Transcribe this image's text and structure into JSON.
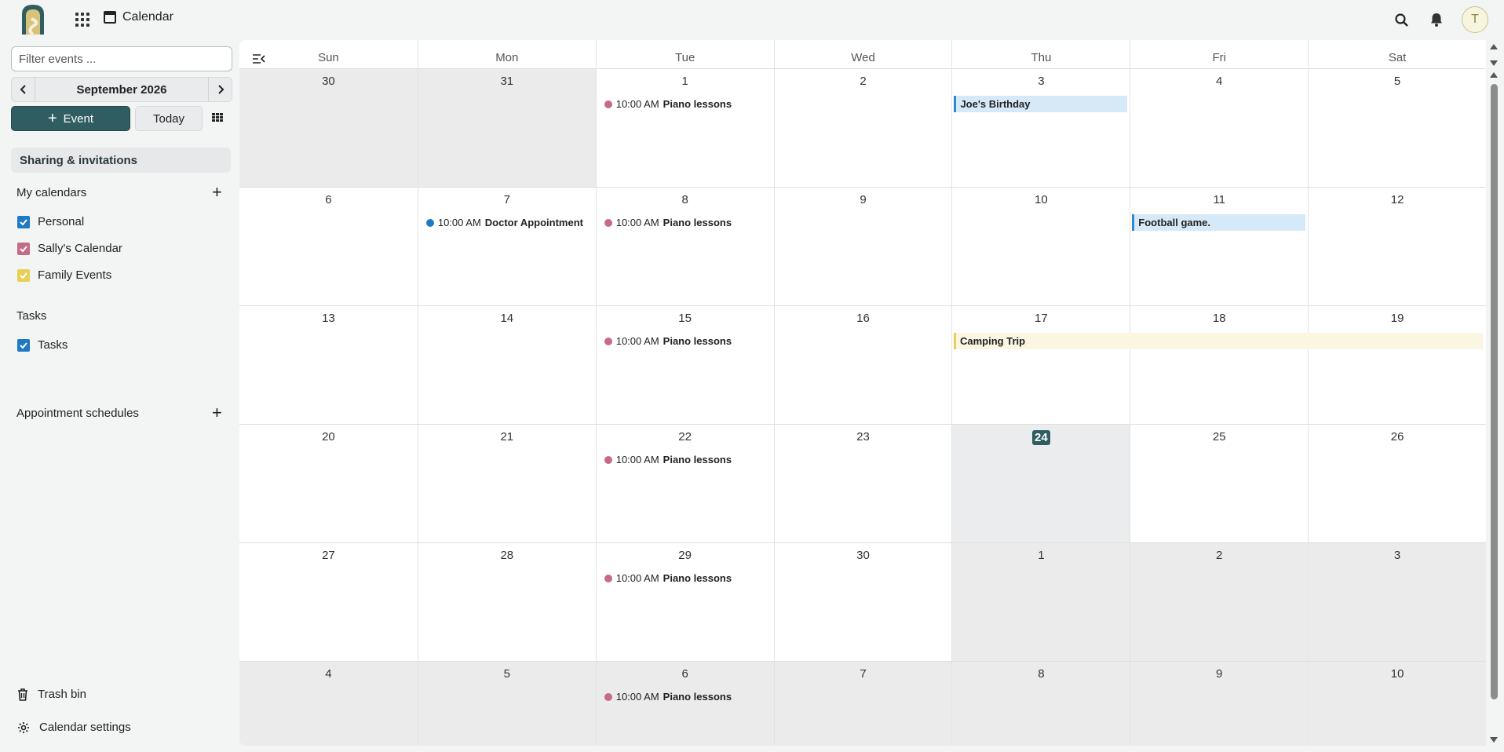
{
  "header": {
    "app_title": "Calendar",
    "avatar_letter": "T"
  },
  "sidebar": {
    "filter_placeholder": "Filter events ...",
    "month_label": "September 2026",
    "event_button": "Event",
    "today_button": "Today",
    "sharing_label": "Sharing & invitations",
    "my_calendars_title": "My calendars",
    "calendars": [
      {
        "label": "Personal",
        "color": "#1f7ac1"
      },
      {
        "label": "Sally's Calendar",
        "color": "#c56b86"
      },
      {
        "label": "Family Events",
        "color": "#e8cf55"
      }
    ],
    "tasks_title": "Tasks",
    "tasks_item": "Tasks",
    "appointments_title": "Appointment schedules",
    "trash_label": "Trash bin",
    "settings_label": "Calendar settings"
  },
  "calendar": {
    "weekdays": [
      "Sun",
      "Mon",
      "Tue",
      "Wed",
      "Thu",
      "Fri",
      "Sat"
    ],
    "weeks": [
      [
        "30",
        "31",
        "1",
        "2",
        "3",
        "4",
        "5"
      ],
      [
        "6",
        "7",
        "8",
        "9",
        "10",
        "11",
        "12"
      ],
      [
        "13",
        "14",
        "15",
        "16",
        "17",
        "18",
        "19"
      ],
      [
        "20",
        "21",
        "22",
        "23",
        "24",
        "25",
        "26"
      ],
      [
        "27",
        "28",
        "29",
        "30",
        "1",
        "2",
        "3"
      ],
      [
        "4",
        "5",
        "6",
        "7",
        "8",
        "9",
        "10"
      ]
    ],
    "today": "24",
    "events": {
      "piano_time": "10:00 AM",
      "piano_name": "Piano lessons",
      "doctor_time": "10:00 AM",
      "doctor_name": "Doctor Appointment",
      "birthday": "Joe's Birthday",
      "football": "Football game.",
      "camping": "Camping Trip"
    }
  }
}
